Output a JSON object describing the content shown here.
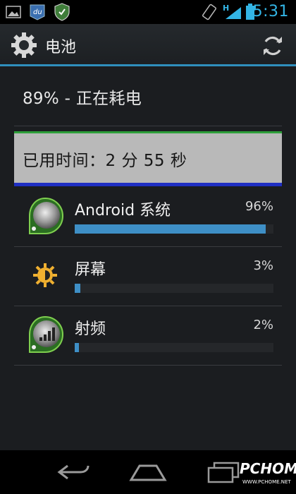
{
  "status_bar": {
    "time": "5:31",
    "network": "H",
    "colors": {
      "accent": "#33b5e5"
    },
    "left_icons": [
      "gallery-notification-icon",
      "du-app-icon",
      "shield-app-icon"
    ],
    "right_icons": [
      "screen-rotation-icon",
      "signal-icon",
      "battery-icon"
    ]
  },
  "action_bar": {
    "title": "电池",
    "icons": [
      "gear-icon",
      "refresh-icon"
    ],
    "divider_color": "#2f8fbd"
  },
  "summary": {
    "text": "89% - 正在耗电"
  },
  "usage": {
    "text": "已用时间：2 分 55 秒",
    "colors": {
      "banner": "#b9b9b9",
      "top_line": "#2d9f39",
      "bottom_line": "#1f2fc3"
    }
  },
  "items": [
    {
      "label": "Android 系统",
      "percent_text": "96%",
      "percent": 96,
      "icon": "android-system-icon"
    },
    {
      "label": "屏幕",
      "percent_text": "3%",
      "percent": 3,
      "icon": "brightness-icon"
    },
    {
      "label": "射频",
      "percent_text": "2%",
      "percent": 2,
      "icon": "cell-signal-icon"
    }
  ],
  "bar_color": "#3e8fc6",
  "nav_bar": {
    "buttons": [
      "back-icon",
      "home-icon",
      "recent-apps-icon"
    ]
  },
  "watermark": {
    "text": "PCHOME",
    "sub": "WWW.PCHOME.NET"
  }
}
